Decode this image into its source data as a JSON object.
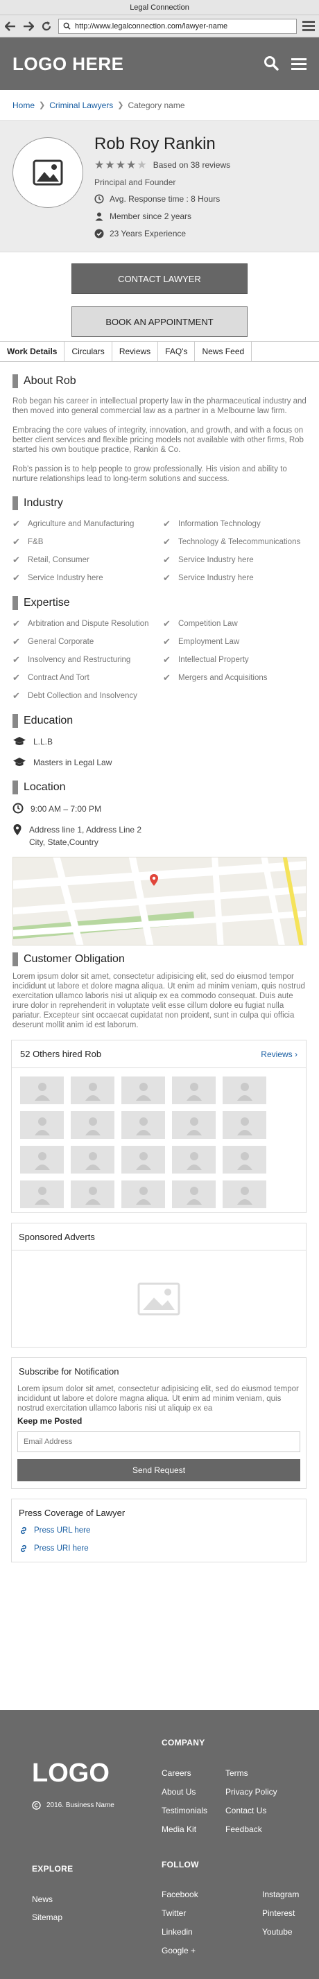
{
  "window": {
    "title": "Legal Connection"
  },
  "browser": {
    "url": "http://www.legalconnection.com/lawyer-name"
  },
  "header": {
    "logo": "LOGO HERE"
  },
  "breadcrumb": {
    "home": "Home",
    "category_link": "Criminal Lawyers",
    "current": "Category name"
  },
  "profile": {
    "name": "Rob Roy Rankin",
    "rating": 4,
    "rating_max": 5,
    "reviews": "Based on 38 reviews",
    "role": "Principal and Founder",
    "facts": [
      "Avg. Response time : 8 Hours",
      "Member since 2 years",
      "23 Years Experience"
    ]
  },
  "actions": {
    "contact": "CONTACT LAWYER",
    "book": "BOOK AN APPOINTMENT"
  },
  "tabs": [
    "Work Details",
    "Circulars",
    "Reviews",
    "FAQ's",
    "News Feed"
  ],
  "about": {
    "title": "About Rob",
    "paragraphs": [
      "Rob began his career in intellectual property law in the pharmaceutical industry and then moved into general commercial law as a partner in a Melbourne law firm.",
      "Embracing the core values of integrity, innovation, and growth, and with a focus on better client services and flexible pricing models not available with other firms, Rob started his own boutique practice, Rankin & Co.",
      "Rob's passion is to help people to grow professionally. His vision and ability to nurture relationships lead to long-term solutions and success."
    ]
  },
  "industry": {
    "title": "Industry",
    "items": [
      "Agriculture and Manufacturing",
      "Information Technology",
      "F&B",
      "Technology & Telecommunications",
      "Retail, Consumer",
      "Service Industry here",
      "Service Industry here",
      "Service Industry here"
    ]
  },
  "expertise": {
    "title": "Expertise",
    "items": [
      "Arbitration and Dispute Resolution",
      "Competition Law",
      "General Corporate",
      "Employment Law",
      "Insolvency and Restructuring",
      "Intellectual Property",
      "Contract And Tort",
      "Mergers and Acquisitions",
      "Debt Collection and Insolvency"
    ]
  },
  "education": {
    "title": "Education",
    "items": [
      "L.L.B",
      "Masters in Legal Law"
    ]
  },
  "location": {
    "title": "Location",
    "hours": "9:00 AM – 7:00 PM",
    "address_line1": "Address line 1, Address Line 2",
    "address_line2": "City, State,Country"
  },
  "obligation": {
    "title": "Customer Obligation",
    "text": "Lorem ipsum dolor sit amet, consectetur adipisicing elit, sed do eiusmod tempor incididunt ut labore et dolore magna aliqua. Ut enim ad minim veniam, quis nostrud exercitation ullamco laboris nisi ut aliquip ex ea commodo consequat. Duis aute irure dolor in reprehenderit in voluptate velit esse cillum dolore eu fugiat nulla pariatur. Excepteur sint occaecat cupidatat non proident, sunt in culpa qui officia deserunt mollit anim id est laborum."
  },
  "hired": {
    "title": "52 Others hired Rob",
    "link": "Reviews"
  },
  "sponsored": {
    "title": "Sponsored Adverts"
  },
  "subscribe": {
    "title": "Subscribe for Notification",
    "text": "Lorem ipsum dolor sit amet, consectetur adipisicing elit, sed do eiusmod tempor incididunt ut labore et dolore magna aliqua. Ut enim ad minim veniam, quis nostrud exercitation ullamco laboris nisi ut aliquip ex ea",
    "keep_label": "Keep me Posted",
    "email_placeholder": "Email Address",
    "button": "Send Request"
  },
  "press": {
    "title": "Press Coverage of Lawyer",
    "links": [
      "Press URL here",
      "Press URI here"
    ]
  },
  "footer": {
    "logo": "LOGO",
    "copyright": "2016. Business Name",
    "company_title": "COMPANY",
    "company_col1": [
      "Careers",
      "About Us",
      "Testimonials",
      "Media Kit"
    ],
    "company_col2": [
      "Terms",
      "Privacy Policy",
      "Contact Us",
      "Feedback"
    ],
    "explore_title": "EXPLORE",
    "explore_links": [
      "News",
      "Sitemap"
    ],
    "follow_title": "FOLLOW",
    "follow_col1": [
      "Facebook",
      "Twitter",
      "Linkedin",
      "Google +"
    ],
    "follow_col2": [
      "Instagram",
      "Pinterest",
      "Youtube"
    ]
  }
}
